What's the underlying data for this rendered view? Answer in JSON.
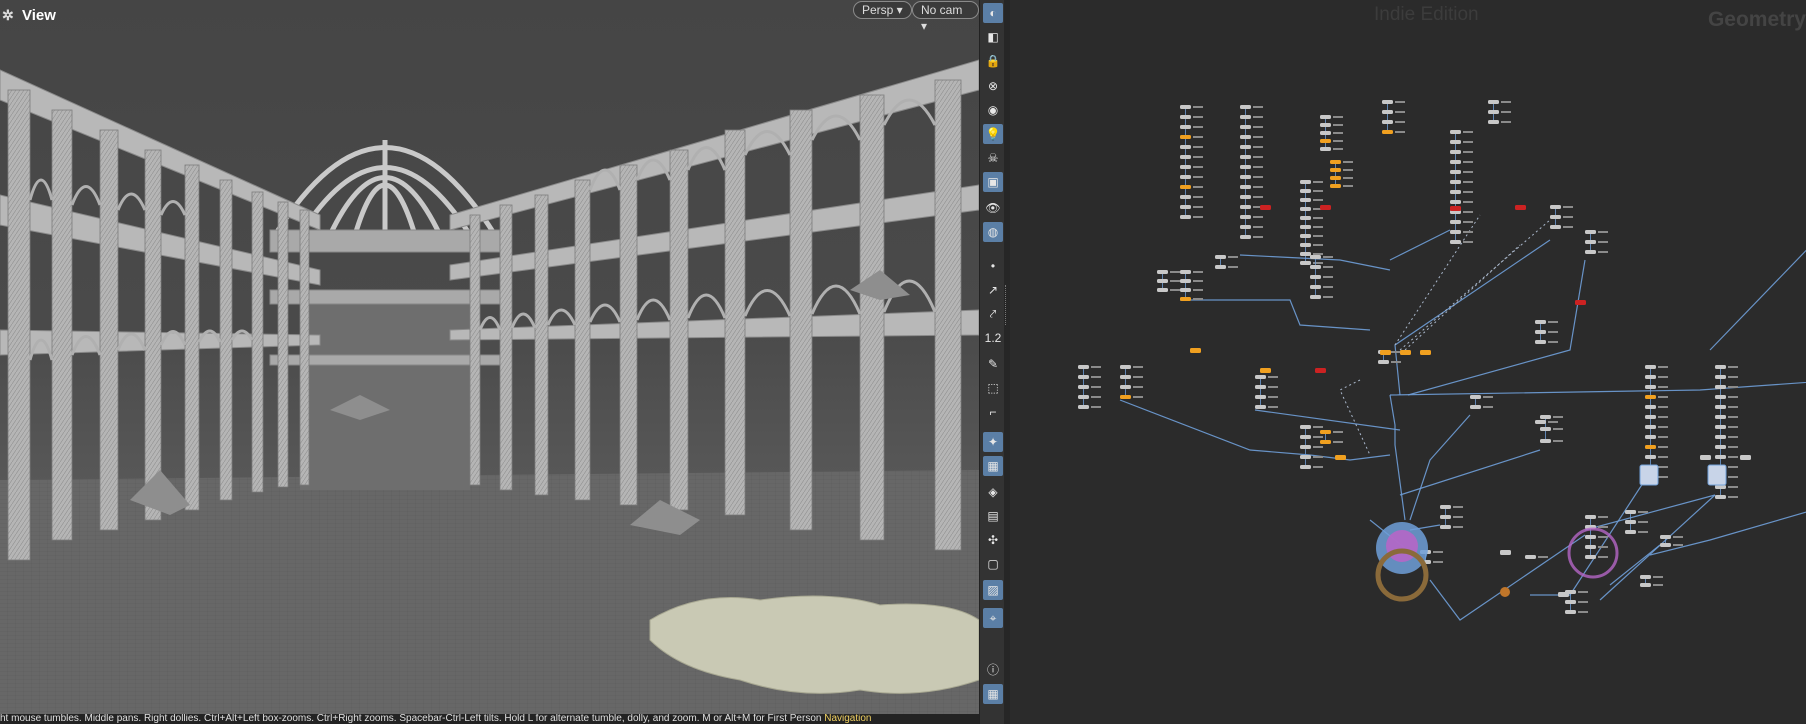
{
  "viewport": {
    "title": "View",
    "view_menu": "Persp ▾",
    "camera_menu": "No cam ▾",
    "status_prefix": "ht mouse tumbles. Middle pans. Right dollies. Ctrl+Alt+Left box-zooms. Ctrl+Right zooms. Spacebar-Ctrl-Left tilts. Hold L for alternate tumble, dolly, and zoom.   M or Alt+M for First Person ",
    "status_highlight": "Navigation"
  },
  "toolbar": {
    "buttons": [
      {
        "name": "wireframe-shading-button",
        "glyph": "◐",
        "active": true
      },
      {
        "name": "ghost-display-button",
        "glyph": "◧",
        "active": false
      },
      {
        "name": "lock-camera-button",
        "glyph": "🔒",
        "active": false
      },
      {
        "name": "hide-others-button",
        "glyph": "⊗",
        "active": false
      },
      {
        "name": "display-toggle-button",
        "glyph": "◉",
        "active": false
      },
      {
        "name": "light-button",
        "glyph": "💡",
        "active": true
      },
      {
        "name": "headlight-button",
        "glyph": "☠",
        "active": false
      },
      {
        "name": "render-preview-button",
        "glyph": "▣",
        "active": true
      },
      {
        "name": "visibility-button",
        "glyph": "👁",
        "active": false
      },
      {
        "name": "selection-button",
        "glyph": "◍",
        "active": true
      },
      {
        "name": "point-display-button",
        "glyph": "•",
        "active": false
      },
      {
        "name": "normals-button",
        "glyph": "↗",
        "active": false
      },
      {
        "name": "vertex-normals-button",
        "glyph": "⤤",
        "active": false
      },
      {
        "name": "numbers-button",
        "glyph": "1.2",
        "active": false
      },
      {
        "name": "paint-button",
        "glyph": "✎",
        "active": false
      },
      {
        "name": "texture-button",
        "glyph": "⬚",
        "active": false
      },
      {
        "name": "guide-button",
        "glyph": "⌐",
        "active": false
      },
      {
        "name": "snap-button",
        "glyph": "✦",
        "active": true
      },
      {
        "name": "checker-button",
        "glyph": "▦",
        "active": true
      },
      {
        "name": "grid-button",
        "glyph": "◈",
        "active": false
      },
      {
        "name": "uv-button",
        "glyph": "▤",
        "active": false
      },
      {
        "name": "handle-button",
        "glyph": "✣",
        "active": false
      },
      {
        "name": "background-button",
        "glyph": "▢",
        "active": false
      },
      {
        "name": "snapshot-button",
        "glyph": "▨",
        "active": true
      },
      {
        "name": "location-button",
        "glyph": "⌖",
        "active": true
      },
      {
        "name": "info-button",
        "glyph": "ⓘ",
        "active": false
      },
      {
        "name": "layout-button",
        "glyph": "▦",
        "active": true
      }
    ]
  },
  "network": {
    "watermark": "Indie Edition",
    "context": "Geometry",
    "colors": {
      "wire": "#6f9fd8",
      "node": "#c8c8c8",
      "node_orange": "#f0a020",
      "node_red": "#cc2222",
      "output_ring": "#8a6a3a",
      "display_ring": "#b566c7",
      "bg": "#2b2b2b"
    }
  },
  "colors": {
    "viewport_bg": "#4a4a4a",
    "floor": "#6a6a6a",
    "structure": "#bdbdbd",
    "active_tool": "#5b7fa6"
  }
}
